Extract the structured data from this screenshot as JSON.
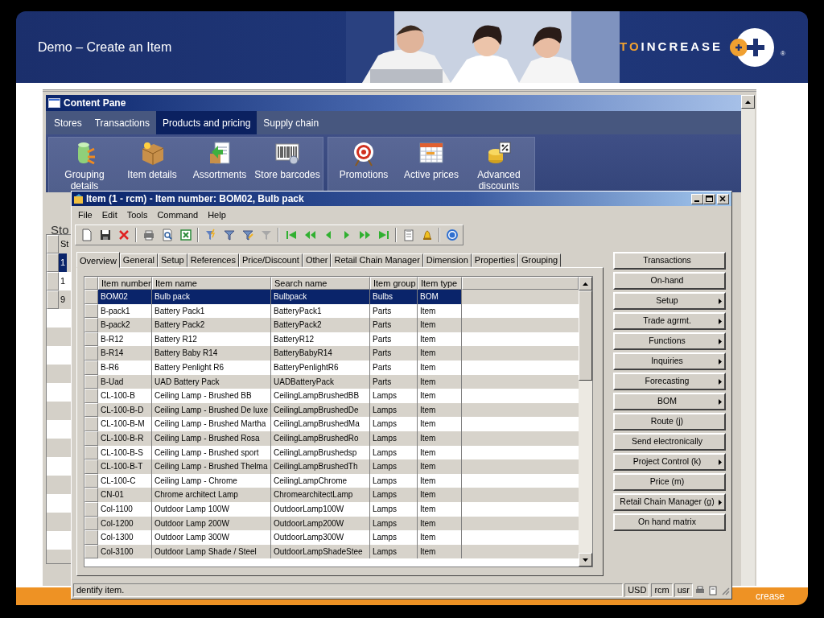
{
  "slide": {
    "title": "Demo – Create an Item",
    "logo": {
      "accent": "TO",
      "text": "INCREASE",
      "mark": "®"
    },
    "footer_text": "crease"
  },
  "content_pane": {
    "title": "Content Pane",
    "tabs": [
      {
        "label": "Stores",
        "selected": false
      },
      {
        "label": "Transactions",
        "selected": false
      },
      {
        "label": "Products and pricing",
        "selected": true
      },
      {
        "label": "Supply chain",
        "selected": false
      }
    ],
    "ribbon_groups": [
      {
        "buttons": [
          {
            "label": "Grouping details",
            "kind": "grouping"
          },
          {
            "label": "Item details",
            "kind": "box"
          },
          {
            "label": "Assortments",
            "kind": "document"
          },
          {
            "label": "Store barcodes",
            "kind": "barcode"
          }
        ]
      },
      {
        "buttons": [
          {
            "label": "Promotions",
            "kind": "target"
          },
          {
            "label": "Active prices",
            "kind": "calendar"
          },
          {
            "label": "Advanced discounts",
            "kind": "coins"
          }
        ]
      }
    ],
    "list_label": "Sto",
    "grid": {
      "column": "St",
      "rows": [
        {
          "cell": "1",
          "selected": true
        },
        {
          "cell": "1",
          "selected": false
        },
        {
          "cell": "9",
          "selected": false
        }
      ]
    }
  },
  "item_window": {
    "title": "Item (1 - rcm) - Item number: BOM02, Bulb pack",
    "menu": [
      "File",
      "Edit",
      "Tools",
      "Command",
      "Help"
    ],
    "tabs": [
      {
        "label": "Overview",
        "selected": true
      },
      {
        "label": "General",
        "selected": false
      },
      {
        "label": "Setup",
        "selected": false
      },
      {
        "label": "References",
        "selected": false
      },
      {
        "label": "Price/Discount",
        "selected": false
      },
      {
        "label": "Other",
        "selected": false
      },
      {
        "label": "Retail Chain Manager",
        "selected": false
      },
      {
        "label": "Dimension",
        "selected": false
      },
      {
        "label": "Properties",
        "selected": false
      },
      {
        "label": "Grouping",
        "selected": false
      }
    ],
    "grid": {
      "columns": [
        "Item number",
        "Item name",
        "Search name",
        "Item group",
        "Item type"
      ],
      "rows": [
        {
          "cells": [
            "BOM02",
            "Bulb pack",
            "Bulbpack",
            "Bulbs",
            "BOM"
          ],
          "selected": true
        },
        {
          "cells": [
            "B-pack1",
            "Battery Pack1",
            "BatteryPack1",
            "Parts",
            "Item"
          ],
          "selected": false
        },
        {
          "cells": [
            "B-pack2",
            "Battery Pack2",
            "BatteryPack2",
            "Parts",
            "Item"
          ],
          "selected": false
        },
        {
          "cells": [
            "B-R12",
            "Battery R12",
            "BatteryR12",
            "Parts",
            "Item"
          ],
          "selected": false
        },
        {
          "cells": [
            "B-R14",
            "Battery Baby R14",
            "BatteryBabyR14",
            "Parts",
            "Item"
          ],
          "selected": false
        },
        {
          "cells": [
            "B-R6",
            "Battery Penlight R6",
            "BatteryPenlightR6",
            "Parts",
            "Item"
          ],
          "selected": false
        },
        {
          "cells": [
            "B-Uad",
            "UAD Battery Pack",
            "UADBatteryPack",
            "Parts",
            "Item"
          ],
          "selected": false
        },
        {
          "cells": [
            "CL-100-B",
            "Ceiling Lamp - Brushed BB",
            "CeilingLampBrushedBB",
            "Lamps",
            "Item"
          ],
          "selected": false
        },
        {
          "cells": [
            "CL-100-B-D",
            "Ceiling Lamp - Brushed De luxe",
            "CeilingLampBrushedDe",
            "Lamps",
            "Item"
          ],
          "selected": false
        },
        {
          "cells": [
            "CL-100-B-M",
            "Ceiling Lamp - Brushed Martha",
            "CeilingLampBrushedMa",
            "Lamps",
            "Item"
          ],
          "selected": false
        },
        {
          "cells": [
            "CL-100-B-R",
            "Ceiling Lamp - Brushed Rosa",
            "CeilingLampBrushedRo",
            "Lamps",
            "Item"
          ],
          "selected": false
        },
        {
          "cells": [
            "CL-100-B-S",
            "Ceiling Lamp - Brushed sport",
            "CeilingLampBrushedsp",
            "Lamps",
            "Item"
          ],
          "selected": false
        },
        {
          "cells": [
            "CL-100-B-T",
            "Ceiling Lamp - Brushed Thelma",
            "CeilingLampBrushedTh",
            "Lamps",
            "Item"
          ],
          "selected": false
        },
        {
          "cells": [
            "CL-100-C",
            "Ceiling Lamp - Chrome",
            "CeilingLampChrome",
            "Lamps",
            "Item"
          ],
          "selected": false
        },
        {
          "cells": [
            "CN-01",
            "Chrome architect Lamp",
            "ChromearchitectLamp",
            "Lamps",
            "Item"
          ],
          "selected": false
        },
        {
          "cells": [
            "Col-1100",
            "Outdoor Lamp 100W",
            "OutdoorLamp100W",
            "Lamps",
            "Item"
          ],
          "selected": false
        },
        {
          "cells": [
            "Col-1200",
            "Outdoor Lamp 200W",
            "OutdoorLamp200W",
            "Lamps",
            "Item"
          ],
          "selected": false
        },
        {
          "cells": [
            "Col-1300",
            "Outdoor Lamp 300W",
            "OutdoorLamp300W",
            "Lamps",
            "Item"
          ],
          "selected": false
        },
        {
          "cells": [
            "Col-3100",
            "Outdoor Lamp Shade / Steel",
            "OutdoorLampShadeStee",
            "Lamps",
            "Item"
          ],
          "selected": false
        }
      ]
    },
    "buttons": [
      {
        "label": "Transactions",
        "submenu": false
      },
      {
        "label": "On-hand",
        "submenu": false
      },
      {
        "label": "Setup",
        "submenu": true
      },
      {
        "label": "Trade agrmt.",
        "submenu": true
      },
      {
        "label": "Functions",
        "submenu": true
      },
      {
        "label": "Inquiries",
        "submenu": true
      },
      {
        "label": "Forecasting",
        "submenu": true
      },
      {
        "label": "BOM",
        "submenu": true
      },
      {
        "label": "Route (j)",
        "submenu": false
      },
      {
        "label": "Send electronically",
        "submenu": false
      },
      {
        "label": "Project Control (k)",
        "submenu": true
      },
      {
        "label": "Price (m)",
        "submenu": false
      },
      {
        "label": "Retail Chain Manager (g)",
        "submenu": true
      },
      {
        "label": "On hand matrix",
        "submenu": false
      }
    ],
    "status_bar": {
      "message": "dentify item.",
      "fields": [
        "USD",
        "rcm",
        "usr"
      ]
    }
  }
}
